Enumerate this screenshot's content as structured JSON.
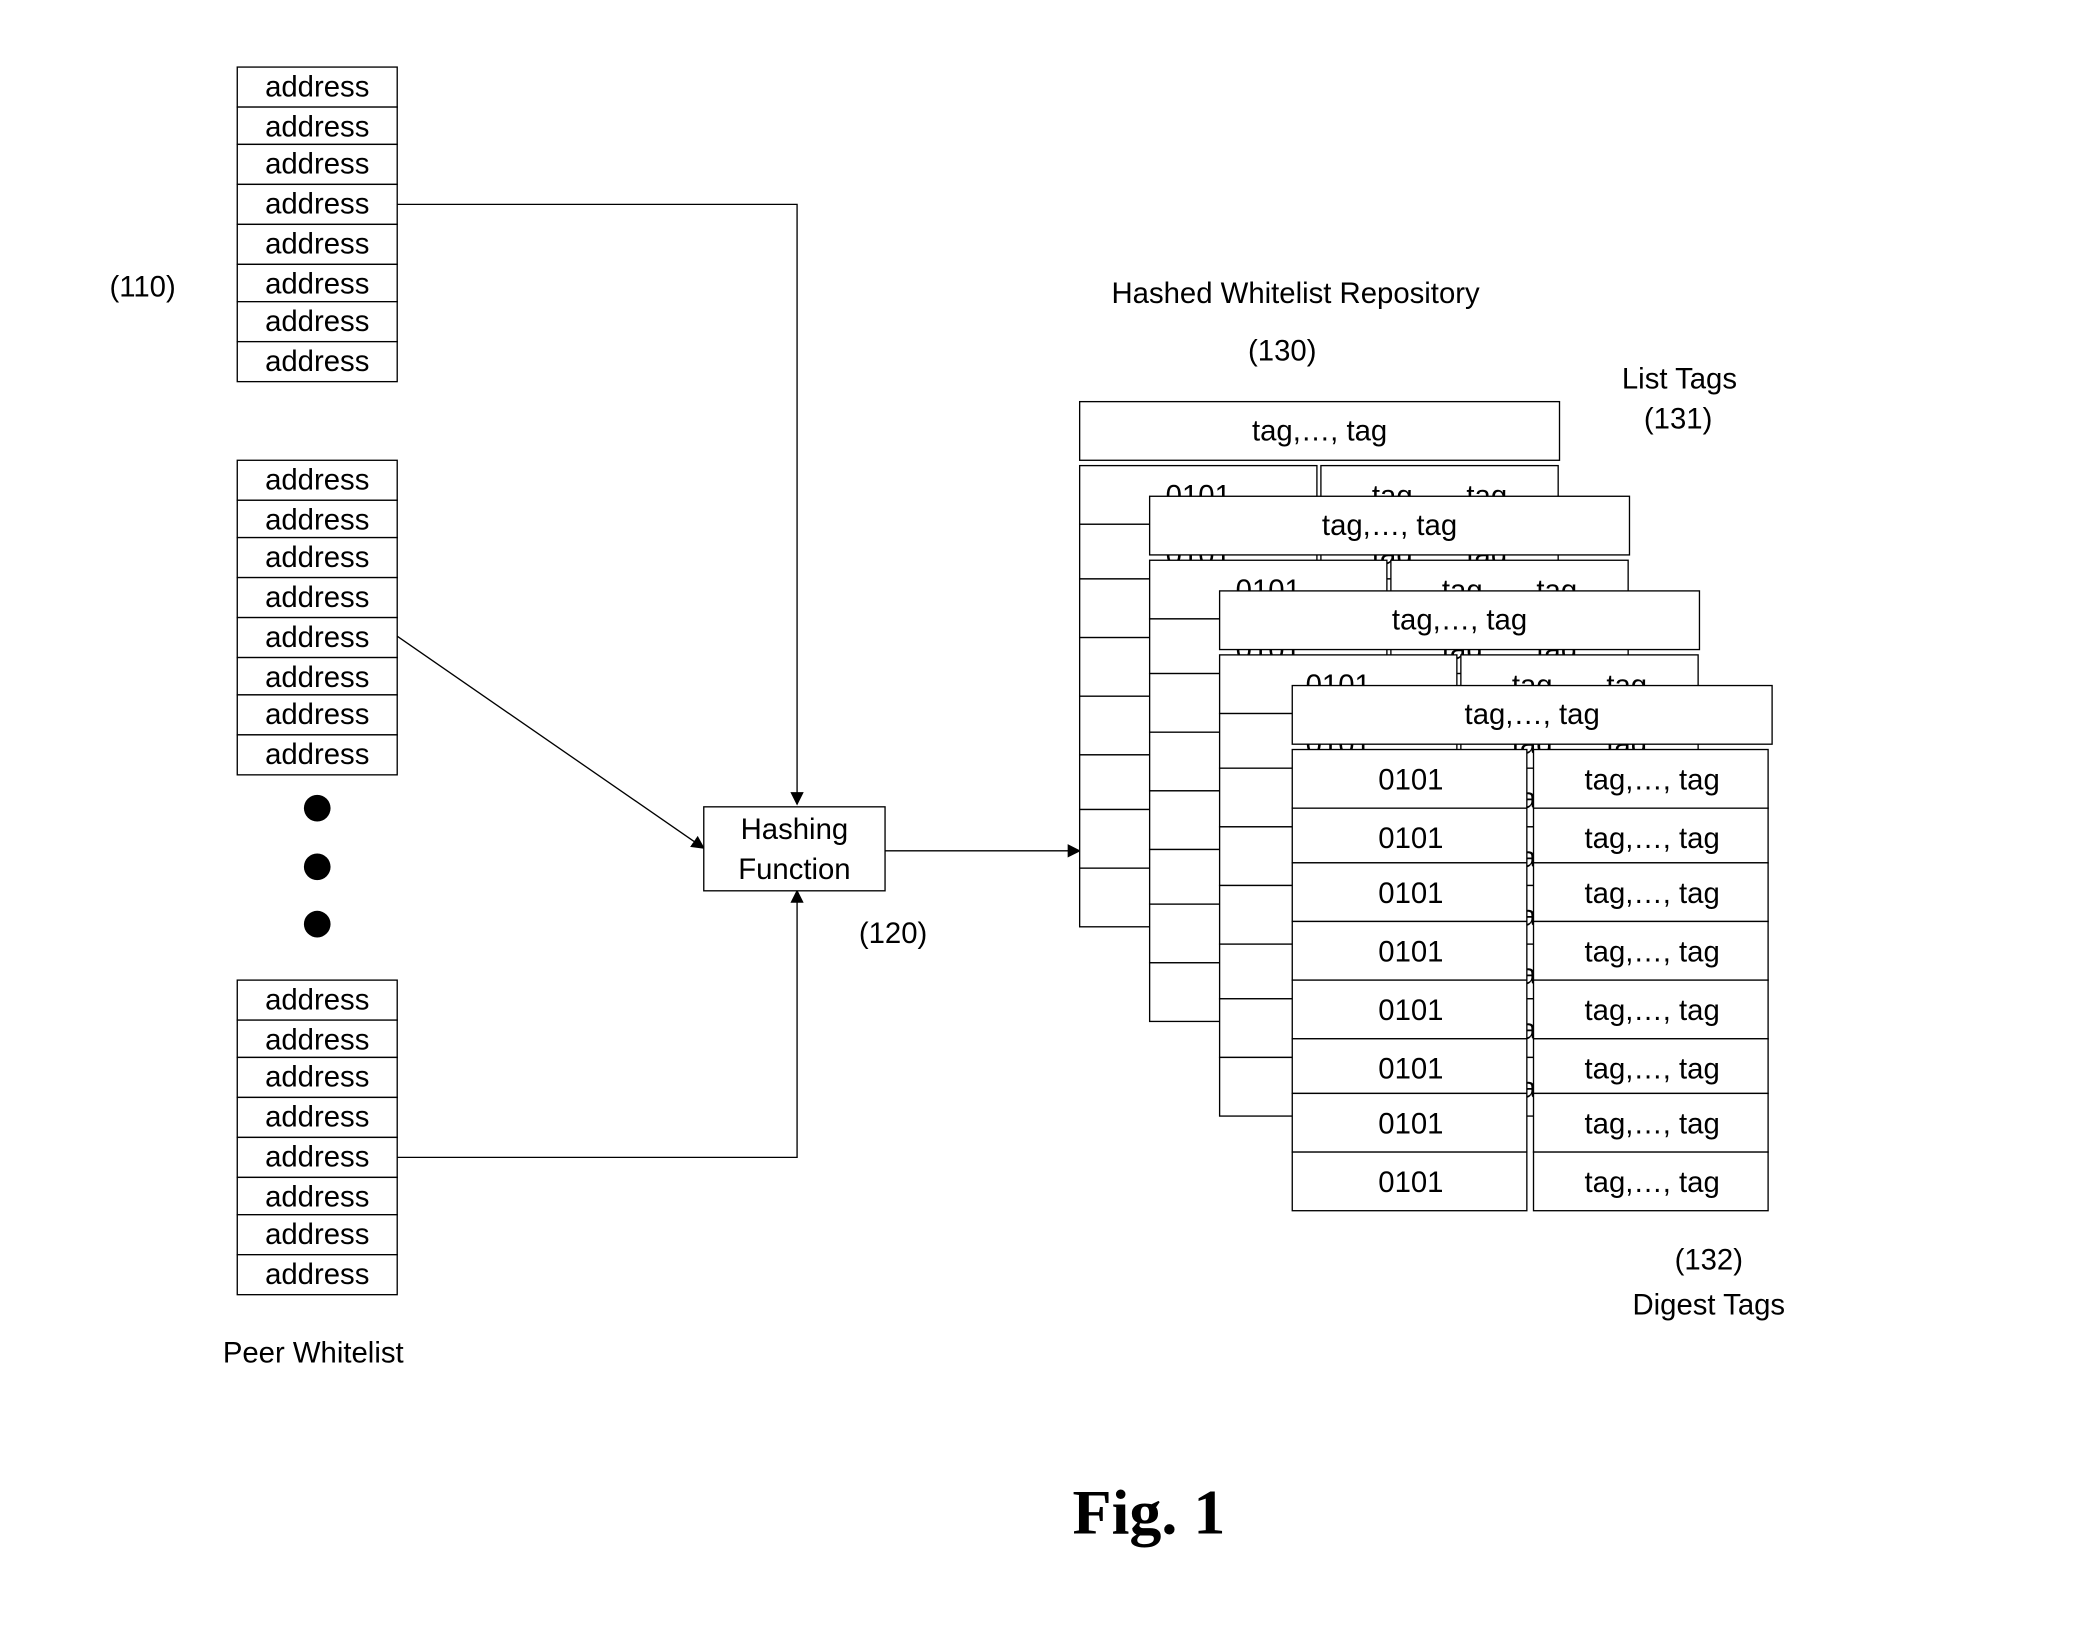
{
  "figure_label": "Fig. 1",
  "peer_whitelist": {
    "label": "Peer Whitelist",
    "ref": "(110)",
    "lists": [
      {
        "entries": [
          "address",
          "address",
          "address",
          "address",
          "address",
          "address",
          "address",
          "address"
        ]
      },
      {
        "entries": [
          "address",
          "address",
          "address",
          "address",
          "address",
          "address",
          "address",
          "address"
        ]
      },
      {
        "entries": [
          "address",
          "address",
          "address",
          "address",
          "address",
          "address",
          "address",
          "address"
        ]
      }
    ],
    "ellipsis_dots": 3
  },
  "hashing_function": {
    "label_line1": "Hashing",
    "label_line2": "Function",
    "ref": "(120)"
  },
  "repository": {
    "title": "Hashed Whitelist Repository",
    "ref": "(130)",
    "list_tags_label": "List Tags",
    "list_tags_ref": "(131)",
    "digest_tags_ref": "(132)",
    "digest_tags_label": "Digest Tags",
    "layers": 4,
    "layer_header": "tag,…, tag",
    "rows": [
      {
        "digest": "0101",
        "tags": "tag,…, tag"
      },
      {
        "digest": "0101",
        "tags": "tag,…, tag"
      },
      {
        "digest": "0101",
        "tags": "tag,…, tag"
      },
      {
        "digest": "0101",
        "tags": "tag,…, tag"
      },
      {
        "digest": "0101",
        "tags": "tag,…, tag"
      },
      {
        "digest": "0101",
        "tags": "tag,…, tag"
      },
      {
        "digest": "0101",
        "tags": "tag,…, tag"
      },
      {
        "digest": "0101",
        "tags": "tag,…, tag"
      }
    ],
    "hidden_row_fragment_digest": "0101",
    "hidden_row_fragment_tags": "tag,…, tag"
  }
}
